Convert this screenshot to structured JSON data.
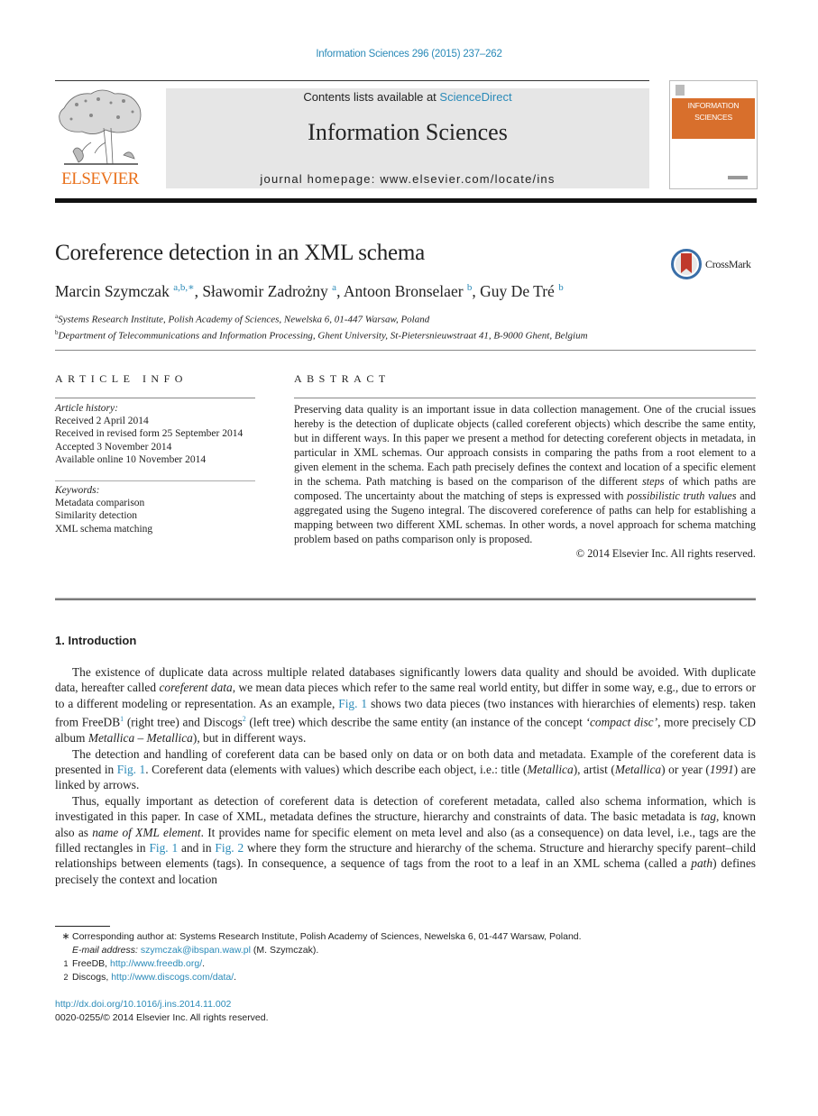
{
  "header": {
    "journal_ref": "Information Sciences 296 (2015) 237–262",
    "contents_prefix": "Contents lists available at ",
    "contents_link": "ScienceDirect",
    "journal_title": "Information Sciences",
    "homepage": "journal homepage: www.elsevier.com/locate/ins",
    "publisher_logo_text": "ELSEVIER",
    "cover": {
      "line1": "INFORMATION",
      "line2": "SCIENCES",
      "accent_color": "#d86f2c"
    },
    "colors": {
      "link": "#2a8ab8",
      "publisher": "#e9711c"
    }
  },
  "article": {
    "title": "Coreference detection in an XML schema",
    "crossmark_label": "CrossMark",
    "authors": [
      {
        "name": "Marcin Szymczak",
        "sup": "a,b,∗",
        "sep": ", "
      },
      {
        "name": "Sławomir Zadrożny",
        "sup": "a",
        "sep": ", "
      },
      {
        "name": "Antoon Bronselaer",
        "sup": "b",
        "sep": ", "
      },
      {
        "name": "Guy De Tré",
        "sup": "b",
        "sep": ""
      }
    ],
    "affiliations": [
      {
        "mark": "a",
        "text": "Systems Research Institute, Polish Academy of Sciences, Newelska 6, 01-447 Warsaw, Poland"
      },
      {
        "mark": "b",
        "text": "Department of Telecommunications and Information Processing, Ghent University, St-Pietersnieuwstraat 41, B-9000 Ghent, Belgium"
      }
    ]
  },
  "article_info": {
    "heading": "ARTICLE INFO",
    "history_label": "Article history:",
    "history": [
      "Received 2 April 2014",
      "Received in revised form 25 September 2014",
      "Accepted 3 November 2014",
      "Available online 10 November 2014"
    ],
    "keywords_label": "Keywords:",
    "keywords": [
      "Metadata comparison",
      "Similarity detection",
      "XML schema matching"
    ]
  },
  "abstract": {
    "heading": "ABSTRACT",
    "p1": "Preserving data quality is an important issue in data collection management. One of the crucial issues hereby is the detection of duplicate objects (called coreferent objects) which describe the same entity, but in different ways. In this paper we present a method for detecting coreferent objects in metadata, in particular in XML schemas. Our approach consists in comparing the paths from a root element to a given element in the schema. Each path precisely defines the context and location of a specific element in the schema. Path matching is based on the comparison of the different ",
    "em1": "steps",
    "p2": " of which paths are composed. The uncertainty about the matching of steps is expressed with ",
    "em2": "possibilistic truth values",
    "p3": " and aggregated using the Sugeno integral. The discovered coreference of paths can help for establishing a mapping between two different XML schemas. In other words, a novel approach for schema matching problem based on paths comparison only is proposed.",
    "copyright": "© 2014 Elsevier Inc. All rights reserved."
  },
  "introduction": {
    "heading": "1. Introduction",
    "para1": {
      "a": "The existence of duplicate data across multiple related databases significantly lowers data quality and should be avoided. With duplicate data, hereafter called ",
      "em_a": "coreferent data",
      "b": ", we mean data pieces which refer to the same real world entity, but differ in some way, e.g., due to errors or to a different modeling or representation. As an example, ",
      "link1": "Fig. 1",
      "c": " shows two data pieces (two instances with hierarchies of elements) resp. taken from FreeDB",
      "sup1": "1",
      "d": " (right tree) and Discogs",
      "sup2": "2",
      "e": " (left tree) which describe the same entity (an instance of the concept ",
      "em_b": "‘compact disc’",
      "f": ", more precisely CD album ",
      "em_c": "Metallica – Metallica",
      "g": "), but in different ways."
    },
    "para2": {
      "a": "The detection and handling of coreferent data can be based only on data or on both data and metadata. Example of the coreferent data is presented in ",
      "link1": "Fig. 1",
      "b": ". Coreferent data (elements with values) which describe each object, i.e.: title (",
      "em_a": "Metallica",
      "c": "), artist (",
      "em_b": "Metallica",
      "d": ") or year (",
      "em_c": "1991",
      "e": ") are linked by arrows."
    },
    "para3": {
      "a": "Thus, equally important as detection of coreferent data is detection of coreferent metadata, called also schema information, which is investigated in this paper. In case of XML, metadata defines the structure, hierarchy and constraints of data. The basic metadata is ",
      "em_a": "tag",
      "b": ", known also as ",
      "em_b": "name of XML element",
      "c": ". It provides name for specific element on meta level and also (as a consequence) on data level, i.e., tags are the filled rectangles in ",
      "link1": "Fig. 1",
      "d": " and in ",
      "link2": "Fig. 2",
      "e": " where they form the structure and hierarchy of the schema. Structure and hierarchy specify parent–child relationships between elements (tags). In consequence, a sequence of tags from the root to a leaf in an XML schema (called a ",
      "em_c": "path",
      "f": ") defines precisely the context and location"
    }
  },
  "footnotes": {
    "corresponding_mark": "∗",
    "corresponding": "Corresponding author at: Systems Research Institute, Polish Academy of Sciences, Newelska 6, 01-447 Warsaw, Poland.",
    "email_label": "E-mail address: ",
    "email": "szymczak@ibspan.waw.pl",
    "email_suffix": " (M. Szymczak).",
    "fn1_mark": "1",
    "fn1_text": "FreeDB, ",
    "fn1_link": "http://www.freedb.org/",
    "fn2_mark": "2",
    "fn2_text": "Discogs, ",
    "fn2_link": "http://www.discogs.com/data/",
    "period": "."
  },
  "doi": {
    "link": "http://dx.doi.org/10.1016/j.ins.2014.11.002",
    "issn_copyright": "0020-0255/© 2014 Elsevier Inc. All rights reserved."
  }
}
